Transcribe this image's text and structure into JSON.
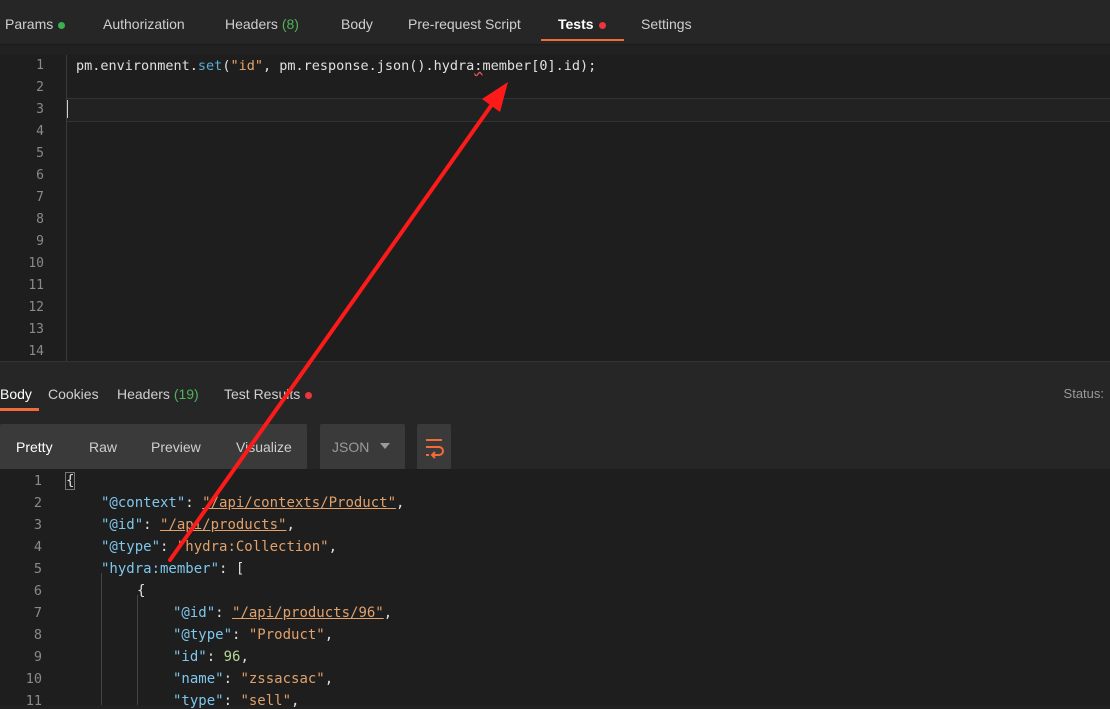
{
  "request_tabs": [
    {
      "label": "Params",
      "badge": "",
      "dot": "green"
    },
    {
      "label": "Authorization",
      "badge": "",
      "dot": ""
    },
    {
      "label": "Headers",
      "badge": "(8)",
      "dot": ""
    },
    {
      "label": "Body",
      "badge": "",
      "dot": ""
    },
    {
      "label": "Pre-request Script",
      "badge": "",
      "dot": ""
    },
    {
      "label": "Tests",
      "badge": "",
      "dot": "red",
      "active": true
    },
    {
      "label": "Settings",
      "badge": "",
      "dot": ""
    }
  ],
  "editor": {
    "line_numbers": [
      "1",
      "2",
      "3",
      "4",
      "5",
      "6",
      "7",
      "8",
      "9",
      "10",
      "11",
      "12",
      "13",
      "14"
    ],
    "line1": {
      "a": "pm.environment.",
      "fn": "set",
      "b": "(",
      "s": "\"id\"",
      "c": ", pm.response.json().hydra",
      "colon": ":",
      "d": "member[0].id);"
    }
  },
  "response_tabs": [
    {
      "label": "Body",
      "badge": "",
      "active": true
    },
    {
      "label": "Cookies",
      "badge": ""
    },
    {
      "label": "Headers",
      "badge": "(19)"
    },
    {
      "label": "Test Results",
      "badge": "",
      "dot": "red"
    }
  ],
  "status_label": "Status:",
  "view_modes": [
    "Pretty",
    "Raw",
    "Preview",
    "Visualize"
  ],
  "format_select": "JSON",
  "json_lines": {
    "numbers": [
      "1",
      "2",
      "3",
      "4",
      "5",
      "6",
      "7",
      "8",
      "9",
      "10",
      "11"
    ],
    "open_brace": "{",
    "context_key": "\"@context\"",
    "context_val": "\"/api/contexts/Product\"",
    "id_key": "\"@id\"",
    "id_val": "\"/api/products\"",
    "type_key": "\"@type\"",
    "type_val": "\"hydra:Collection\"",
    "member_key": "\"hydra:member\"",
    "member_open": "[",
    "obj_open": "{",
    "item_id_key": "\"@id\"",
    "item_id_val": "\"/api/products/96\"",
    "item_type_key": "\"@type\"",
    "item_type_val": "\"Product\"",
    "item_idnum_key": "\"id\"",
    "item_idnum_val": "96",
    "name_key": "\"name\"",
    "name_val": "\"zssacsac\"",
    "kind_key": "\"type\"",
    "kind_val": "\"sell\""
  },
  "colors": {
    "accent": "#f26b3a",
    "arrow": "#ff0000",
    "bg": "#1e1e1e"
  }
}
